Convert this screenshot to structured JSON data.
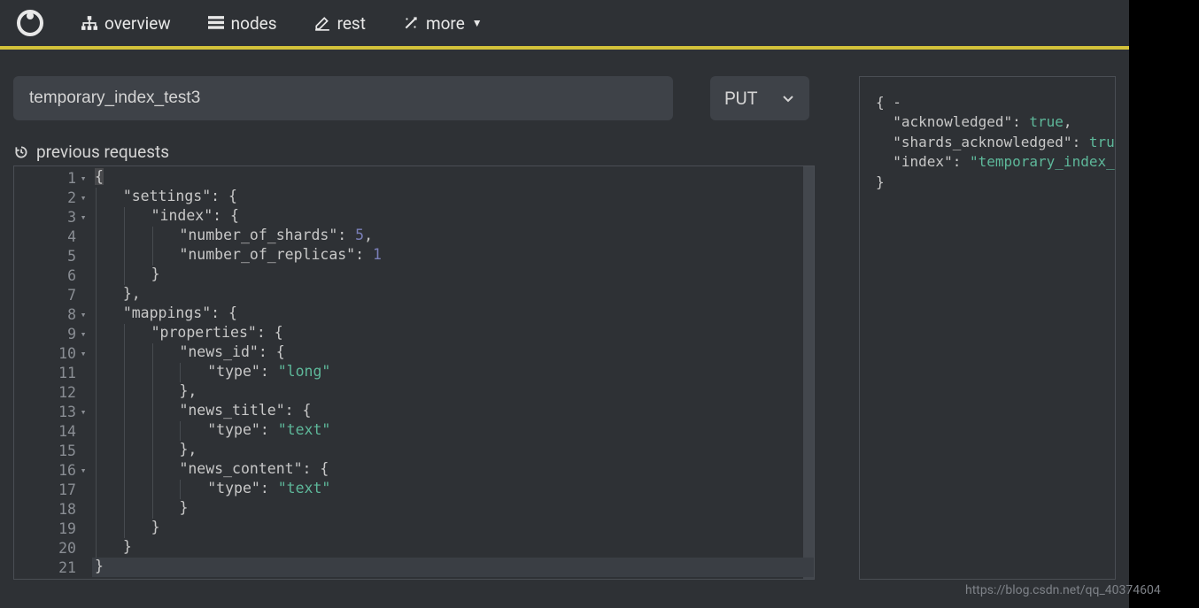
{
  "nav": {
    "overview": "overview",
    "nodes": "nodes",
    "rest": "rest",
    "more": "more"
  },
  "request": {
    "path": "temporary_index_test3",
    "method": "PUT",
    "previous_label": "previous requests"
  },
  "editor": {
    "lines": [
      {
        "n": "1",
        "fold": true,
        "active": false,
        "indent": 0,
        "tokens": [
          {
            "t": "{",
            "c": "punc",
            "cursor": true
          }
        ]
      },
      {
        "n": "2",
        "fold": true,
        "active": false,
        "indent": 1,
        "tokens": [
          {
            "t": "\"settings\"",
            "c": "key"
          },
          {
            "t": ": ",
            "c": "punc"
          },
          {
            "t": "{",
            "c": "punc"
          }
        ]
      },
      {
        "n": "3",
        "fold": true,
        "active": false,
        "indent": 2,
        "tokens": [
          {
            "t": "\"index\"",
            "c": "key"
          },
          {
            "t": ": ",
            "c": "punc"
          },
          {
            "t": "{",
            "c": "punc"
          }
        ]
      },
      {
        "n": "4",
        "fold": false,
        "active": false,
        "indent": 3,
        "tokens": [
          {
            "t": "\"number_of_shards\"",
            "c": "key"
          },
          {
            "t": ": ",
            "c": "punc"
          },
          {
            "t": "5",
            "c": "num"
          },
          {
            "t": ",",
            "c": "punc"
          }
        ]
      },
      {
        "n": "5",
        "fold": false,
        "active": false,
        "indent": 3,
        "tokens": [
          {
            "t": "\"number_of_replicas\"",
            "c": "key"
          },
          {
            "t": ": ",
            "c": "punc"
          },
          {
            "t": "1",
            "c": "num"
          }
        ]
      },
      {
        "n": "6",
        "fold": false,
        "active": false,
        "indent": 2,
        "tokens": [
          {
            "t": "}",
            "c": "punc"
          }
        ]
      },
      {
        "n": "7",
        "fold": false,
        "active": false,
        "indent": 1,
        "tokens": [
          {
            "t": "},",
            "c": "punc"
          }
        ]
      },
      {
        "n": "8",
        "fold": true,
        "active": false,
        "indent": 1,
        "tokens": [
          {
            "t": "\"mappings\"",
            "c": "key"
          },
          {
            "t": ": ",
            "c": "punc"
          },
          {
            "t": "{",
            "c": "punc"
          }
        ]
      },
      {
        "n": "9",
        "fold": true,
        "active": false,
        "indent": 2,
        "tokens": [
          {
            "t": "\"properties\"",
            "c": "key"
          },
          {
            "t": ": ",
            "c": "punc"
          },
          {
            "t": "{",
            "c": "punc"
          }
        ]
      },
      {
        "n": "10",
        "fold": true,
        "active": false,
        "indent": 3,
        "tokens": [
          {
            "t": "\"news_id\"",
            "c": "key"
          },
          {
            "t": ": ",
            "c": "punc"
          },
          {
            "t": "{",
            "c": "punc"
          }
        ]
      },
      {
        "n": "11",
        "fold": false,
        "active": false,
        "indent": 4,
        "tokens": [
          {
            "t": "\"type\"",
            "c": "key"
          },
          {
            "t": ": ",
            "c": "punc"
          },
          {
            "t": "\"long\"",
            "c": "str"
          }
        ]
      },
      {
        "n": "12",
        "fold": false,
        "active": false,
        "indent": 3,
        "tokens": [
          {
            "t": "},",
            "c": "punc"
          }
        ]
      },
      {
        "n": "13",
        "fold": true,
        "active": false,
        "indent": 3,
        "tokens": [
          {
            "t": "\"news_title\"",
            "c": "key"
          },
          {
            "t": ": ",
            "c": "punc"
          },
          {
            "t": "{",
            "c": "punc"
          }
        ]
      },
      {
        "n": "14",
        "fold": false,
        "active": false,
        "indent": 4,
        "tokens": [
          {
            "t": "\"type\"",
            "c": "key"
          },
          {
            "t": ": ",
            "c": "punc"
          },
          {
            "t": "\"text\"",
            "c": "str"
          }
        ]
      },
      {
        "n": "15",
        "fold": false,
        "active": false,
        "indent": 3,
        "tokens": [
          {
            "t": "},",
            "c": "punc"
          }
        ]
      },
      {
        "n": "16",
        "fold": true,
        "active": false,
        "indent": 3,
        "tokens": [
          {
            "t": "\"news_content\"",
            "c": "key"
          },
          {
            "t": ": ",
            "c": "punc"
          },
          {
            "t": "{",
            "c": "punc"
          }
        ]
      },
      {
        "n": "17",
        "fold": false,
        "active": false,
        "indent": 4,
        "tokens": [
          {
            "t": "\"type\"",
            "c": "key"
          },
          {
            "t": ": ",
            "c": "punc"
          },
          {
            "t": "\"text\"",
            "c": "str"
          }
        ]
      },
      {
        "n": "18",
        "fold": false,
        "active": false,
        "indent": 3,
        "tokens": [
          {
            "t": "}",
            "c": "punc"
          }
        ]
      },
      {
        "n": "19",
        "fold": false,
        "active": false,
        "indent": 2,
        "tokens": [
          {
            "t": "}",
            "c": "punc"
          }
        ]
      },
      {
        "n": "20",
        "fold": false,
        "active": false,
        "indent": 1,
        "tokens": [
          {
            "t": "}",
            "c": "punc"
          }
        ]
      },
      {
        "n": "21",
        "fold": false,
        "active": true,
        "indent": 0,
        "tokens": [
          {
            "t": "}",
            "c": "punc"
          }
        ]
      }
    ]
  },
  "response": {
    "lines": [
      [
        {
          "t": "{ ",
          "c": "punc"
        },
        {
          "t": "-",
          "c": "punc"
        }
      ],
      [
        {
          "t": "  ",
          "c": "punc"
        },
        {
          "t": "\"acknowledged\"",
          "c": "key"
        },
        {
          "t": ": ",
          "c": "punc"
        },
        {
          "t": "true",
          "c": "bool"
        },
        {
          "t": ",",
          "c": "punc"
        }
      ],
      [
        {
          "t": "  ",
          "c": "punc"
        },
        {
          "t": "\"shards_acknowledged\"",
          "c": "key"
        },
        {
          "t": ": ",
          "c": "punc"
        },
        {
          "t": "true",
          "c": "bool"
        }
      ],
      [
        {
          "t": "  ",
          "c": "punc"
        },
        {
          "t": "\"index\"",
          "c": "key"
        },
        {
          "t": ": ",
          "c": "punc"
        },
        {
          "t": "\"temporary_index_t",
          "c": "str"
        }
      ],
      [
        {
          "t": "}",
          "c": "punc"
        }
      ]
    ]
  },
  "watermark": "https://blog.csdn.net/qq_40374604"
}
